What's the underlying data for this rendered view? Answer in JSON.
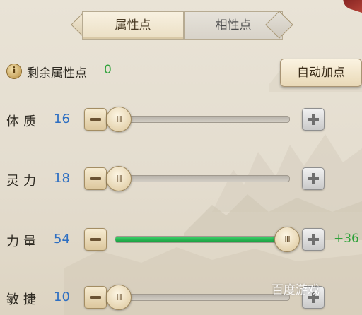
{
  "tabs": [
    {
      "label": "属性点",
      "active": true
    },
    {
      "label": "相性点",
      "active": false
    }
  ],
  "remaining": {
    "icon": "info-icon",
    "icon_glyph": "i",
    "label": "剩余属性点",
    "value": "0"
  },
  "auto_button": {
    "label": "自动加点"
  },
  "attributes": [
    {
      "name": "体质",
      "value": "16",
      "fill": 0.0,
      "bonus": ""
    },
    {
      "name": "灵力",
      "value": "18",
      "fill": 0.0,
      "bonus": ""
    },
    {
      "name": "力量",
      "value": "54",
      "fill": 1.0,
      "bonus": "+36"
    },
    {
      "name": "敏捷",
      "value": "10",
      "fill": 0.0,
      "bonus": ""
    }
  ],
  "knob_glyph": "III",
  "watermark": "百度游戏",
  "colors": {
    "value_blue": "#2e6fc2",
    "bonus_green": "#2fa23a",
    "fill_green": "#22b04c"
  }
}
